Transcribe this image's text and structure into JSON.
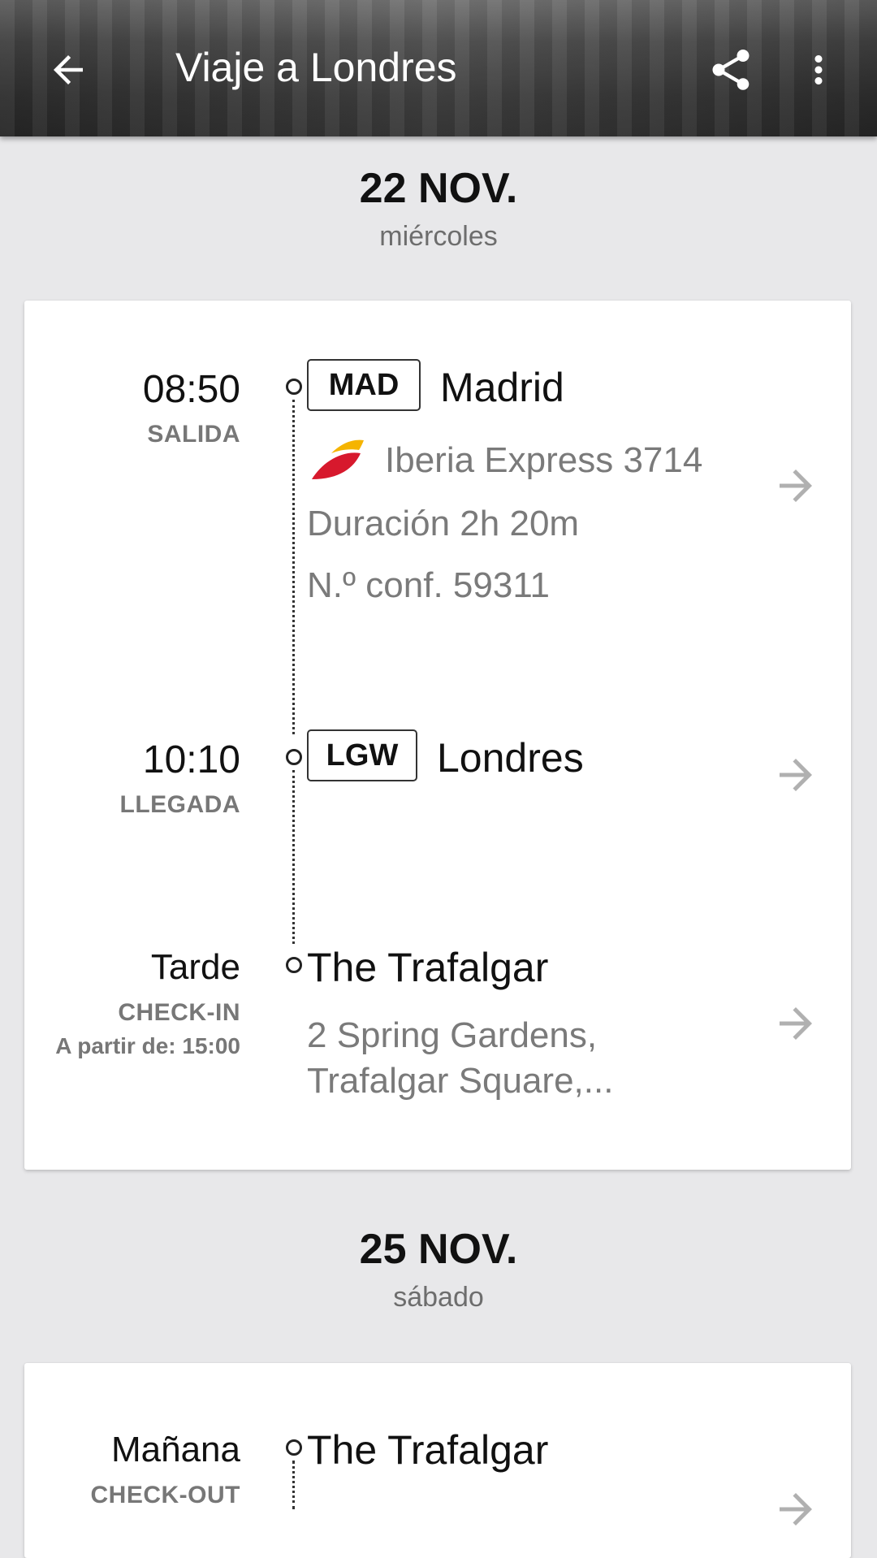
{
  "appbar": {
    "title": "Viaje a Londres",
    "back_icon": "arrow-left-icon",
    "share_icon": "share-icon",
    "more_icon": "more-vert-icon"
  },
  "days": [
    {
      "date": "22 NOV.",
      "weekday": "miércoles",
      "events": {
        "departure": {
          "time": "08:50",
          "label": "SALIDA",
          "code": "MAD",
          "city": "Madrid",
          "airline": "Iberia Express 3714",
          "airline_icon": "iberia-logo-icon",
          "duration": "Duración 2h 20m",
          "confirmation": "N.º conf. 59311"
        },
        "arrival": {
          "time": "10:10",
          "label": "LLEGADA",
          "code": "LGW",
          "city": "Londres"
        },
        "checkin": {
          "time": "Tarde",
          "label": "CHECK-IN",
          "note": "A partir de: 15:00",
          "hotel": "The Trafalgar",
          "address_line1": "2 Spring Gardens,",
          "address_line2": "Trafalgar Square,..."
        }
      }
    },
    {
      "date": "25 NOV.",
      "weekday": "sábado",
      "events": {
        "checkout": {
          "time": "Mañana",
          "label": "CHECK-OUT",
          "hotel": "The Trafalgar"
        }
      }
    }
  ],
  "colors": {
    "background": "#e8e8ea",
    "card": "#ffffff",
    "secondary_text": "#7a7a7a",
    "arrow": "#b0b0b0",
    "iberia_red": "#d7192d",
    "iberia_yellow": "#f5b400"
  }
}
